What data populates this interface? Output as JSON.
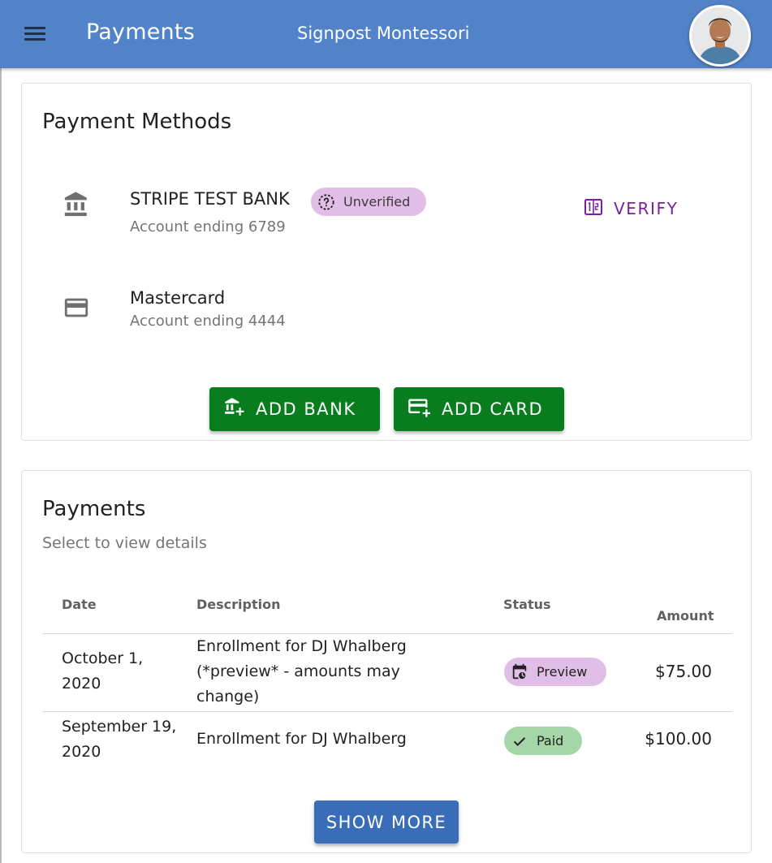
{
  "app_bar": {
    "title": "Payments",
    "school": "Signpost Montessori",
    "menu_icon": "menu-icon",
    "avatar": "user-avatar"
  },
  "payment_methods": {
    "title": "Payment Methods",
    "items": [
      {
        "icon": "bank-icon",
        "name": "STRIPE TEST BANK",
        "detail": "Account ending 6789",
        "status": "Unverified",
        "status_icon": "dashed-help-circle-icon",
        "action": "VERIFY",
        "action_icon": "dialpad-icon"
      },
      {
        "icon": "credit-card-icon",
        "name": "Mastercard",
        "detail": "Account ending 4444"
      }
    ],
    "add_bank_label": "ADD BANK",
    "add_card_label": "ADD CARD"
  },
  "payments": {
    "title": "Payments",
    "subtitle": "Select to view details",
    "columns": [
      "Date",
      "Description",
      "Status",
      "Amount"
    ],
    "rows": [
      {
        "date": "October 1, 2020",
        "description": "Enrollment for DJ Whalberg (*preview* - amounts may change)",
        "status": "Preview",
        "status_icon": "calendar-clock-icon",
        "amount": "$75.00"
      },
      {
        "date": "September 19, 2020",
        "description": "Enrollment for DJ Whalberg",
        "status": "Paid",
        "status_icon": "check-icon",
        "amount": "$100.00"
      }
    ],
    "show_more_label": "SHOW MORE"
  },
  "colors": {
    "app_bar": "#5283c9",
    "primary_button": "#087d1e",
    "show_more_button": "#3a6db7",
    "verify_text": "#7b1fa2",
    "chip_purple": "#e1bee7",
    "chip_green": "#a5d6a7"
  }
}
